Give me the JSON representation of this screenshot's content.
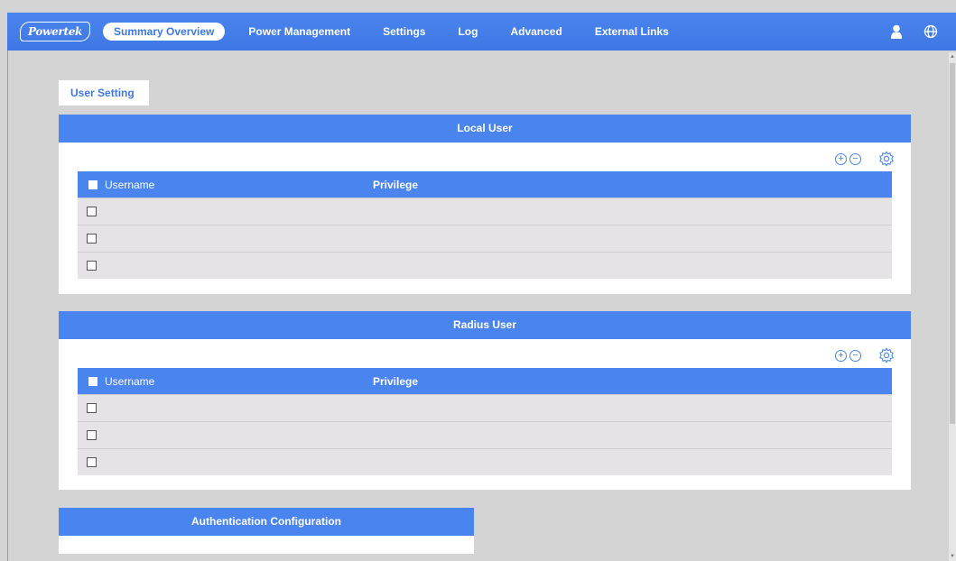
{
  "header": {
    "logo_text": "Powertek",
    "nav": [
      {
        "label": "Summary Overview"
      },
      {
        "label": "Power Management"
      },
      {
        "label": "Settings"
      },
      {
        "label": "Log"
      },
      {
        "label": "Advanced"
      },
      {
        "label": "External Links"
      }
    ],
    "active_nav": "Summary Overview",
    "icons": [
      "user-icon",
      "globe-icon"
    ]
  },
  "tab": {
    "label": "User Setting"
  },
  "local_user": {
    "title": "Local User",
    "columns": [
      "Username",
      "Privilege"
    ],
    "rows": [
      "",
      "",
      ""
    ],
    "tools": [
      "add-icon",
      "remove-icon",
      "gear-icon"
    ]
  },
  "radius_user": {
    "title": "Radius User",
    "columns": [
      "Username",
      "Privilege"
    ],
    "rows": [
      "",
      "",
      ""
    ],
    "tools": [
      "add-icon",
      "remove-icon",
      "gear-icon"
    ]
  },
  "auth_config": {
    "title": "Authentication Configuration"
  },
  "colors": {
    "accent": "#4a84ee",
    "background": "#d4d4d4",
    "row": "#e5e3e5"
  }
}
